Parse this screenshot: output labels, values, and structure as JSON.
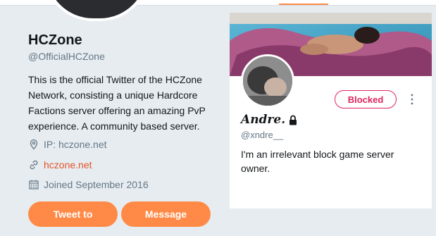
{
  "colors": {
    "accent": "#ff8a47",
    "link": "#e5552a",
    "blocked": "#e0245e",
    "muted": "#657786",
    "background": "#e6ecf0"
  },
  "profile": {
    "name": "HCZone",
    "handle": "@OfficialHCZone",
    "bio": "This is the official Twitter of the HCZone Network, consisting a unique Hardcore Factions server offering an amazing PvP experience. A community based server.",
    "location_label": "IP: hczone.net",
    "location_icon": "map-pin-icon",
    "website": "hczone.net",
    "website_icon": "link-icon",
    "joined": "Joined September 2016",
    "joined_icon": "calendar-icon"
  },
  "actions": {
    "tweet_to": "Tweet to",
    "message": "Message"
  },
  "hover_card": {
    "name": "Andre.",
    "name_icon": "lock-icon",
    "handle": "@xndre__",
    "bio": "I'm an irrelevant block game server owner.",
    "blocked_label": "Blocked",
    "more_icon": "more-vertical-icon"
  }
}
